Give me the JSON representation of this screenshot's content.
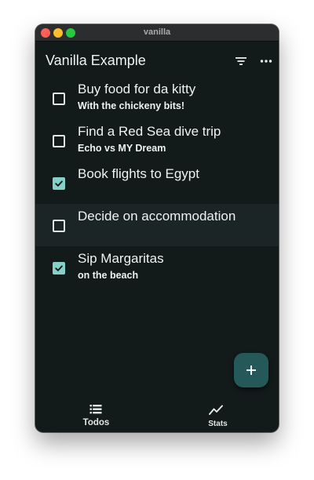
{
  "window": {
    "title": "vanilla"
  },
  "appbar": {
    "title": "Vanilla Example",
    "icons": [
      "filter-icon",
      "more-vert-icon"
    ]
  },
  "todos": [
    {
      "task": "Buy food for da kitty",
      "note": "With the chickeny bits!",
      "complete": false
    },
    {
      "task": "Find a Red Sea dive trip",
      "note": "Echo vs MY Dream",
      "complete": false
    },
    {
      "task": "Book flights to Egypt",
      "note": "",
      "complete": true
    },
    {
      "task": "Decide on accommodation",
      "note": "",
      "complete": false,
      "hovered": true
    },
    {
      "task": "Sip Margaritas",
      "note": "on the beach",
      "complete": true
    }
  ],
  "fab": {
    "icon": "plus-icon"
  },
  "bottom_nav": {
    "items": [
      {
        "label": "Todos",
        "icon": "list-icon",
        "selected": true
      },
      {
        "label": "Stats",
        "icon": "show-chart-icon",
        "selected": false
      }
    ]
  },
  "colors": {
    "background": "#121a1a",
    "accent_checkbox": "#85d1ca",
    "fab": "#255959",
    "text": "#eef2f2"
  }
}
